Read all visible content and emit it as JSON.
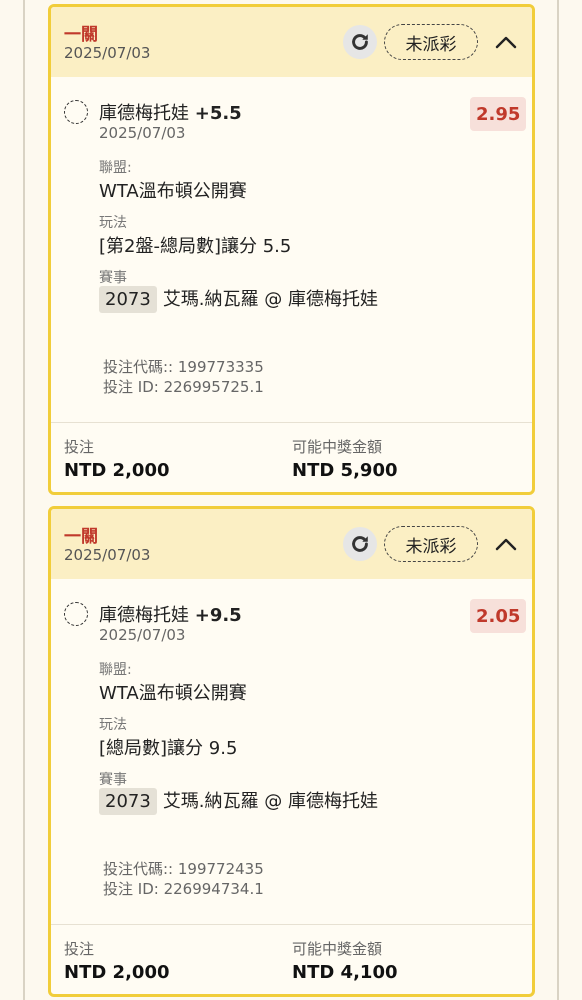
{
  "bets": [
    {
      "type": "一關",
      "date": "2025/07/03",
      "status": "未派彩",
      "selection_name": "庫德梅托娃",
      "handicap": "+5.5",
      "odds": "2.95",
      "selection_date": "2025/07/03",
      "league_label": "聯盟:",
      "league": "WTA溫布頓公開賽",
      "market_label": "玩法",
      "market": "[第2盤-總局數]讓分 5.5",
      "event_label": "賽事",
      "event_code": "2073",
      "event_name": "艾瑪.納瓦羅 @ 庫德梅托娃",
      "bet_code": "投注代碼:: 199773335",
      "bet_id": "投注 ID: 226995725.1",
      "stake_label": "投注",
      "stake": "NTD 2,000",
      "payout_label": "可能中獎金額",
      "payout": "NTD 5,900"
    },
    {
      "type": "一關",
      "date": "2025/07/03",
      "status": "未派彩",
      "selection_name": "庫德梅托娃",
      "handicap": "+9.5",
      "odds": "2.05",
      "selection_date": "2025/07/03",
      "league_label": "聯盟:",
      "league": "WTA溫布頓公開賽",
      "market_label": "玩法",
      "market": "[總局數]讓分 9.5",
      "event_label": "賽事",
      "event_code": "2073",
      "event_name": "艾瑪.納瓦羅 @ 庫德梅托娃",
      "bet_code": "投注代碼:: 199772435",
      "bet_id": "投注 ID: 226994734.1",
      "stake_label": "投注",
      "stake": "NTD 2,000",
      "payout_label": "可能中獎金額",
      "payout": "NTD 4,100"
    }
  ],
  "icons": {
    "refresh": "refresh-icon",
    "collapse": "chevron-up-icon",
    "radio": "radio-unchecked-icon"
  },
  "colors": {
    "card_border": "#f1cd3a",
    "header_bg": "#fbefc4",
    "accent_red": "#c0392b",
    "odds_bg": "#f7e0da"
  }
}
